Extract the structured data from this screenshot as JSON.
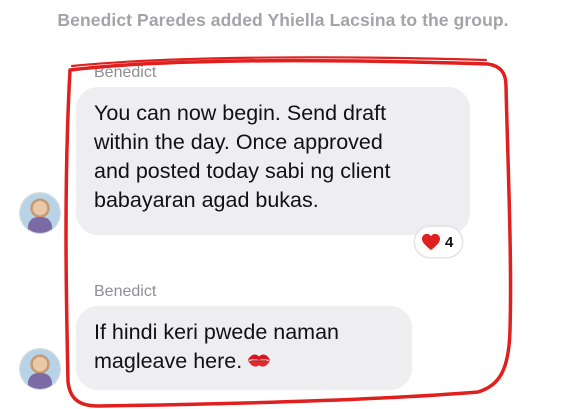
{
  "system_message": "Benedict Paredes added Yhiella Lacsina to the group.",
  "messages": [
    {
      "sender": "Benedict",
      "lines": [
        "You can now begin. Send draft",
        "within the day. Once approved",
        "and posted today sabi ng client",
        "babayaran agad bukas."
      ],
      "reaction": {
        "emoji": "heart-icon",
        "count": "4"
      }
    },
    {
      "sender": "Benedict",
      "lines": [
        "If hindi keri pwede naman",
        "magleave here."
      ],
      "trailing_emoji": "kiss-icon"
    }
  ],
  "colors": {
    "bubble": "#eeeef0",
    "highlight": "#e0201e",
    "system_text": "#a3a3a8"
  }
}
